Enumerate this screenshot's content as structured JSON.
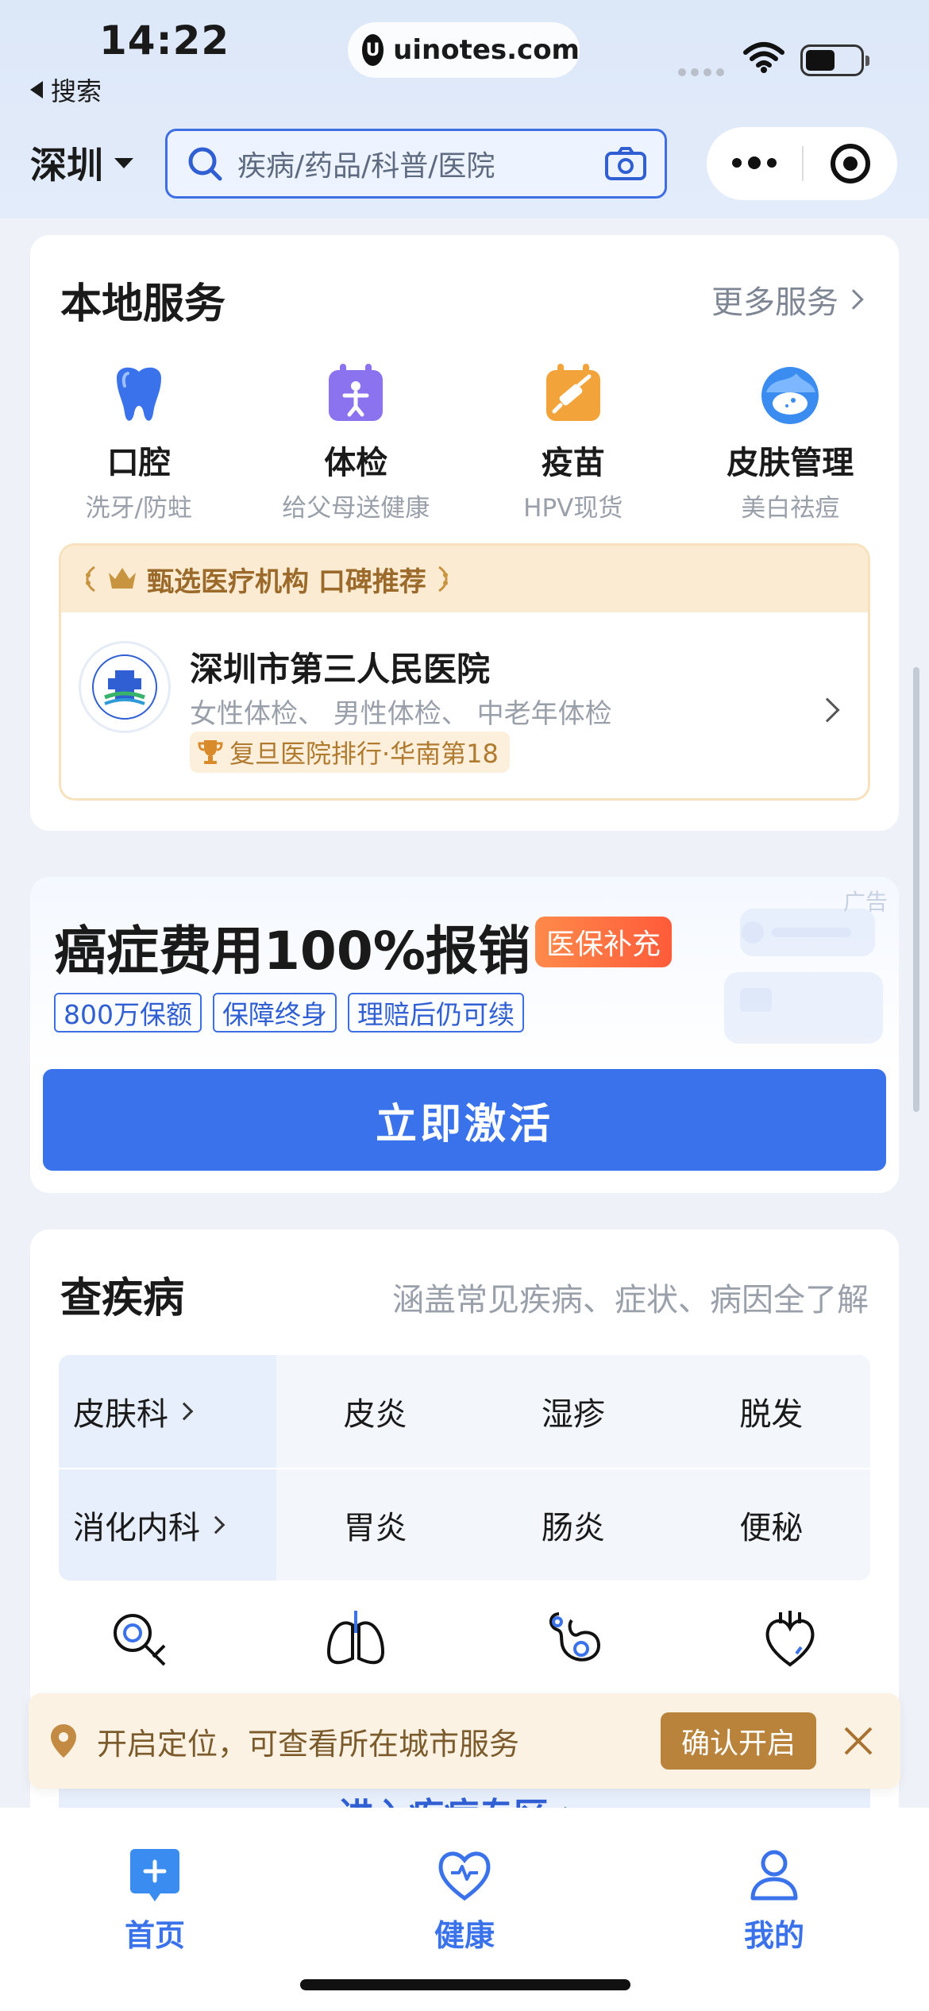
{
  "status_bar": {
    "time": "14:22",
    "back_label": "搜索",
    "url": "uinotes.com"
  },
  "header": {
    "city": "深圳",
    "search_placeholder": "疾病/药品/科普/医院"
  },
  "local_services": {
    "title": "本地服务",
    "more_label": "更多服务",
    "items": [
      {
        "name": "口腔",
        "sub": "洗牙/防蛀",
        "icon": "tooth-icon"
      },
      {
        "name": "体检",
        "sub": "给父母送健康",
        "icon": "checkup-calendar-icon"
      },
      {
        "name": "疫苗",
        "sub": "HPV现货",
        "icon": "vaccine-syringe-icon"
      },
      {
        "name": "皮肤管理",
        "sub": "美白祛痘",
        "icon": "skin-face-icon"
      }
    ],
    "recommend": {
      "header": "甄选医疗机构 口碑推荐",
      "hospital_name": "深圳市第三人民医院",
      "hospital_tags": "女性体检、 男性体检、 中老年体检",
      "rank": "复旦医院排行·华南第18"
    }
  },
  "promo": {
    "ad_label": "广告",
    "title": "癌症费用100%报销",
    "badge": "医保补充",
    "chips": [
      "800万保额",
      "保障终身",
      "理赔后仍可续"
    ],
    "button": "立即激活"
  },
  "disease": {
    "title": "查疾病",
    "subtitle": "涵盖常见疾病、症状、病因全了解",
    "rows": [
      {
        "dept": "皮肤科",
        "items": [
          "皮炎",
          "湿疹",
          "脱发"
        ]
      },
      {
        "dept": "消化内科",
        "items": [
          "胃炎",
          "肠炎",
          "便秘"
        ]
      }
    ],
    "icons": [
      "magnifier-cross-icon",
      "lungs-icon",
      "stomach-icon",
      "heart-icon"
    ],
    "enter_label": "进入疾病专区 >"
  },
  "location_toast": {
    "text": "开启定位，可查看所在城市服务",
    "button": "确认开启"
  },
  "tabbar": {
    "tabs": [
      {
        "label": "首页",
        "icon": "home-plus-icon"
      },
      {
        "label": "健康",
        "icon": "heart-pulse-icon"
      },
      {
        "label": "我的",
        "icon": "user-icon"
      }
    ]
  },
  "colors": {
    "primary": "#3a72ec",
    "gold": "#b9833b",
    "badge_orange": "#ff6b3d"
  }
}
